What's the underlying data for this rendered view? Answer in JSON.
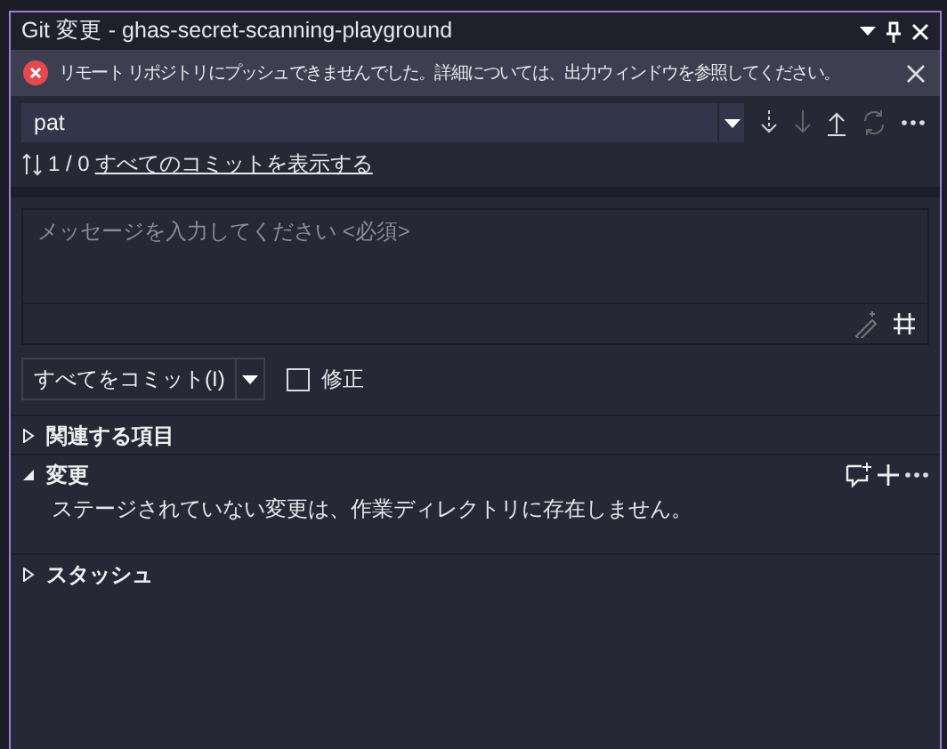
{
  "window": {
    "title": "Git 変更 - ghas-secret-scanning-playground"
  },
  "error_banner": {
    "message": "リモート リポジトリにプッシュできませんでした。詳細については、出力ウィンドウを参照してください。"
  },
  "branch": {
    "value": "pat"
  },
  "sync": {
    "counts": "1 / 0",
    "link": "すべてのコミットを表示する"
  },
  "commit_message": {
    "placeholder": "メッセージを入力してください <必須>"
  },
  "commit_button": {
    "label": "すべてをコミット(I)"
  },
  "amend": {
    "label": "修正",
    "checked": false
  },
  "sections": [
    {
      "title": "関連する項目",
      "expanded": false
    },
    {
      "title": "変更",
      "expanded": true,
      "message": "ステージされていない変更は、作業ディレクトリに存在しません。"
    },
    {
      "title": "スタッシュ",
      "expanded": false
    }
  ]
}
